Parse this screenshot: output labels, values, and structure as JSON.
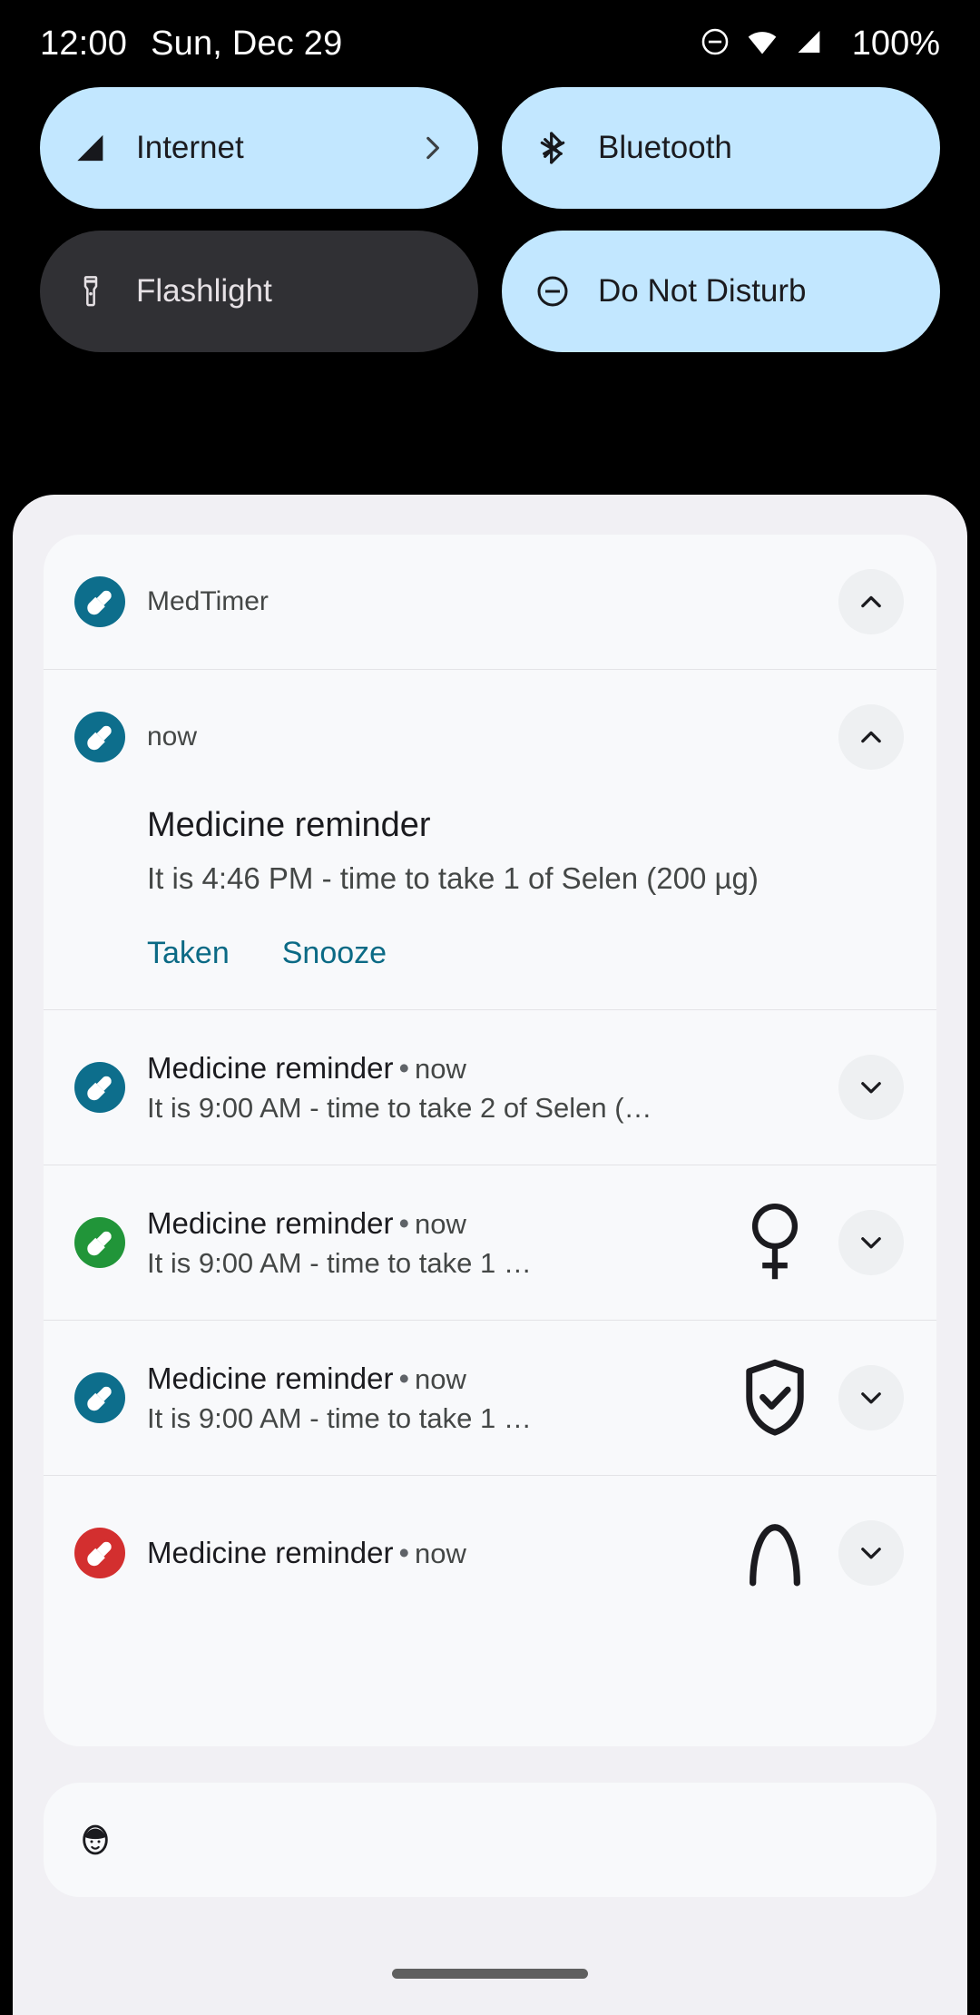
{
  "status_bar": {
    "time": "12:00",
    "date": "Sun, Dec 29",
    "battery": "100%",
    "icons": [
      "do-not-disturb-icon",
      "wifi-icon",
      "cellular-signal-icon"
    ]
  },
  "quick_settings": {
    "tiles": [
      {
        "label": "Internet",
        "icon": "cellular-signal-icon",
        "state": "on",
        "has_chevron": true
      },
      {
        "label": "Bluetooth",
        "icon": "bluetooth-icon",
        "state": "on",
        "has_chevron": false
      },
      {
        "label": "Flashlight",
        "icon": "flashlight-icon",
        "state": "off",
        "has_chevron": false
      },
      {
        "label": "Do Not Disturb",
        "icon": "do-not-disturb-icon",
        "state": "on",
        "has_chevron": false
      }
    ]
  },
  "notification_group": {
    "app_name": "MedTimer",
    "app_icon": "medtimer-pill-icon",
    "collapse_icon": "chevron-up-icon",
    "expanded": {
      "app_icon": "medtimer-pill-icon",
      "time": "now",
      "collapse_icon": "chevron-up-icon",
      "title": "Medicine reminder",
      "body": "It is 4:46 PM - time to take 1 of Selen (200 µg)",
      "actions": [
        {
          "label": "Taken"
        },
        {
          "label": "Snooze"
        }
      ]
    },
    "rows": [
      {
        "icon_color": "teal",
        "title": "Medicine reminder",
        "separator": "•",
        "when": "now",
        "body": "It is 9:00 AM - time to take 2 of Selen (…",
        "badge": "",
        "expand_icon": "chevron-down-icon"
      },
      {
        "icon_color": "green",
        "title": "Medicine reminder",
        "separator": "•",
        "when": "now",
        "body": "It is 9:00 AM - time to take 1 …",
        "badge": "female-venus-icon",
        "expand_icon": "chevron-down-icon"
      },
      {
        "icon_color": "teal",
        "title": "Medicine reminder",
        "separator": "•",
        "when": "now",
        "body": "It is 9:00 AM - time to take 1 …",
        "badge": "shield-check-icon",
        "expand_icon": "chevron-down-icon"
      },
      {
        "icon_color": "red",
        "title": "Medicine reminder",
        "separator": "•",
        "when": "now",
        "body": "",
        "badge": "arc-icon",
        "expand_icon": "chevron-down-icon"
      }
    ]
  },
  "footer": {
    "icon": "face-avatar-icon"
  },
  "nav": {
    "handle": "home-gesture-handle"
  },
  "colors": {
    "tile_active": "#c2e7ff",
    "tile_inactive": "#303034",
    "shade_background": "#f1f0f4",
    "notification_background": "#f8f9fb",
    "accent_action": "#0b6a85",
    "app_icon_teal": "#0d6e8c",
    "app_icon_green": "#219539",
    "app_icon_red": "#d32f2f"
  }
}
